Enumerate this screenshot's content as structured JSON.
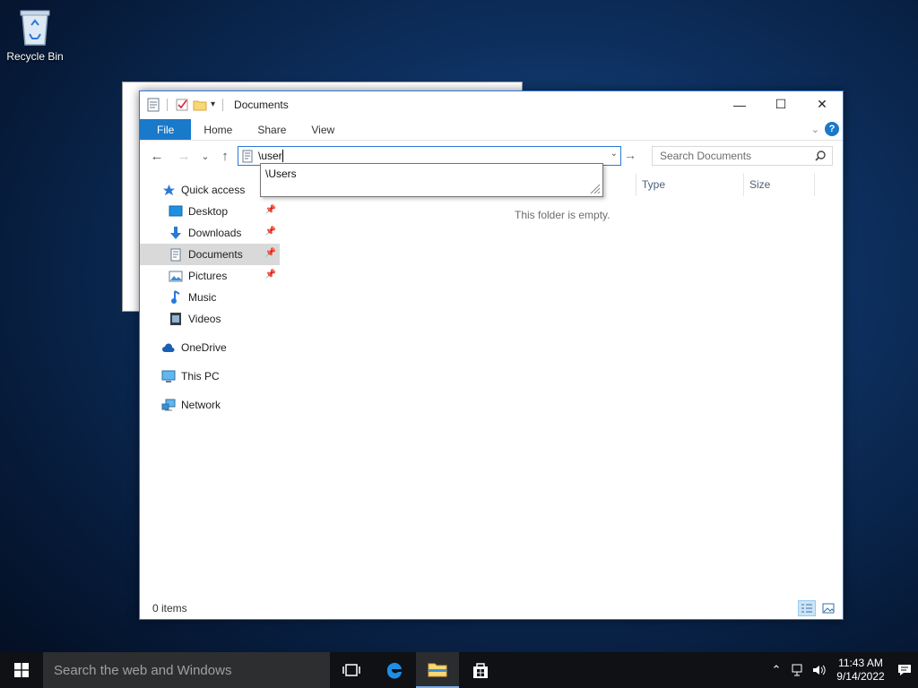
{
  "desktop": {
    "recycle_bin_label": "Recycle Bin"
  },
  "window": {
    "title": "Documents",
    "controls": {
      "minimize": "—",
      "maximize": "☐",
      "close": "✕"
    },
    "ribbon_tabs": [
      "File",
      "Home",
      "Share",
      "View"
    ]
  },
  "navbar": {
    "back": "←",
    "forward": "→",
    "recent": "⌄",
    "up": "↑",
    "address_value": "\\user",
    "go": "→",
    "search_placeholder": "Search Documents"
  },
  "autocomplete": {
    "suggestion": "\\Users"
  },
  "sidebar": {
    "quick_access": "Quick access",
    "items": [
      {
        "label": "Desktop",
        "pinned": true,
        "icon": "desktop-icon"
      },
      {
        "label": "Downloads",
        "pinned": true,
        "icon": "downloads-icon"
      },
      {
        "label": "Documents",
        "pinned": true,
        "icon": "documents-icon",
        "selected": true
      },
      {
        "label": "Pictures",
        "pinned": true,
        "icon": "pictures-icon"
      },
      {
        "label": "Music",
        "pinned": false,
        "icon": "music-icon"
      },
      {
        "label": "Videos",
        "pinned": false,
        "icon": "videos-icon"
      }
    ],
    "onedrive": "OneDrive",
    "this_pc": "This PC",
    "network": "Network"
  },
  "columns": [
    "Type",
    "Size"
  ],
  "content": {
    "empty_message": "This folder is empty."
  },
  "status": {
    "items": "0 items"
  },
  "taskbar": {
    "search_placeholder": "Search the web and Windows",
    "time": "11:43 AM",
    "date": "9/14/2022"
  },
  "colors": {
    "accent": "#1979ca",
    "border": "#2b79d8"
  }
}
